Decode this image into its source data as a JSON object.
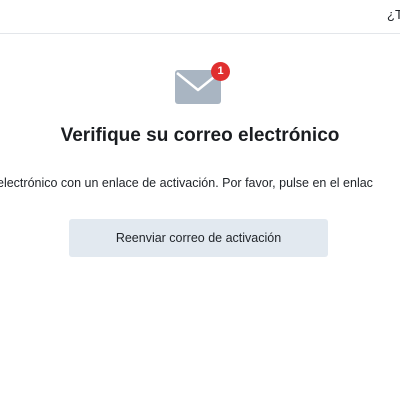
{
  "header": {
    "link_text": "¿T"
  },
  "verify": {
    "mail_icon": "mail-icon",
    "badge_count": "1",
    "title": "Verifique su correo electrónico",
    "message": "electrónico con un enlace de activación. Por favor, pulse en el enlac",
    "resend_label": "Reenviar correo de activación"
  },
  "colors": {
    "badge": "#e02f2f",
    "mail_icon": "#a9b5c2",
    "button_bg": "#e2e9f0"
  }
}
